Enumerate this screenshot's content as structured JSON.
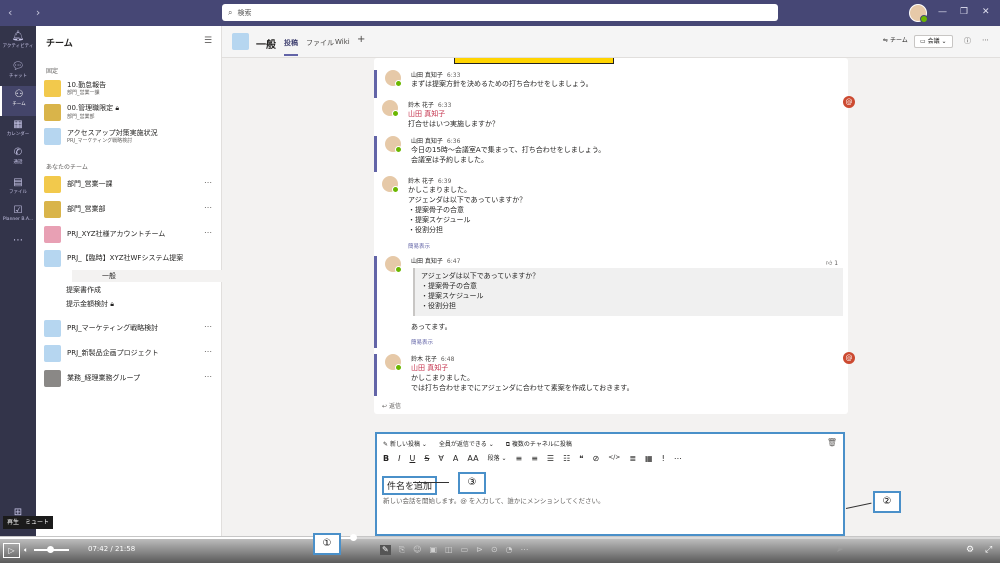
{
  "search": {
    "placeholder": "検索"
  },
  "rail": [
    {
      "label": "アクティビティ",
      "icon": "bell-icon"
    },
    {
      "label": "チャット",
      "icon": "chat-icon"
    },
    {
      "label": "チーム",
      "icon": "teams-icon"
    },
    {
      "label": "カレンダー",
      "icon": "calendar-icon"
    },
    {
      "label": "通話",
      "icon": "phone-icon"
    },
    {
      "label": "ファイル",
      "icon": "file-icon"
    },
    {
      "label": "Planner B.A...",
      "icon": "planner-icon"
    }
  ],
  "teams_pane": {
    "title": "チーム",
    "pinned_label": "固定",
    "pinned": [
      {
        "name": "10.勤怠報告",
        "sub": "部門_営業一課"
      },
      {
        "name": "00.管理職限定",
        "sub": "部門_営業部"
      },
      {
        "name": "アクセスアップ対策実施状況",
        "sub": "PRJ_マーケティング戦略検討"
      }
    ],
    "your_teams_label": "あなたのチーム",
    "teams": [
      {
        "name": "部門_営業一課"
      },
      {
        "name": "部門_営業部"
      },
      {
        "name": "PRJ_XYZ社様アカウントチーム"
      },
      {
        "name": "PRJ_【臨時】XYZ社WFシステム提案"
      },
      {
        "name": "PRJ_マーケティング戦略検討"
      },
      {
        "name": "PRJ_新製品企画プロジェクト"
      },
      {
        "name": "業務_経理業務グループ"
      }
    ],
    "channels": [
      "一般",
      "提案書作成",
      "提示金額検討"
    ]
  },
  "header": {
    "title": "一般",
    "tabs": [
      "投稿",
      "ファイル",
      "Wiki"
    ],
    "team_btn": "チーム",
    "meet_btn": "会議"
  },
  "messages": [
    {
      "author": "山田 真知子",
      "time": "6:33",
      "lines": [
        "まずは提案方針を決めるための打ち合わせをしましょう。"
      ]
    },
    {
      "author": "鈴木 花子",
      "time": "6:33",
      "mention": "山田 真知子",
      "lines": [
        "打合せはいつ実施しますか？"
      ]
    },
    {
      "author": "山田 真知子",
      "time": "6:36",
      "lines": [
        "今日の15時～会議室Aで集まって、打ち合わせをしましょう。",
        "会議室は予約しました。"
      ]
    },
    {
      "author": "鈴木 花子",
      "time": "6:39",
      "lines": [
        "かしこまりました。",
        "アジェンダは以下であっていますか？",
        "・提案骨子の合意",
        "・提案スケジュール",
        "・役割分担"
      ]
    },
    {
      "author": "山田 真知子",
      "time": "6:47",
      "quote": [
        "アジェンダは以下であっていますか？",
        "・提案骨子の合意",
        "・提案スケジュール",
        "・役割分担"
      ],
      "lines": [
        "あってます。"
      ]
    },
    {
      "author": "鈴木 花子",
      "time": "6:48",
      "mention": "山田 真知子",
      "lines": [
        "かしこまりました。",
        "では打ち合わせまでにアジェンダに合わせて素案を作成しておきます。"
      ]
    }
  ],
  "show_less": "簡易表示",
  "reply": "返信",
  "like_count": "1",
  "composer": {
    "post_type": "新しい投稿",
    "reply_setting": "全員が返信できる",
    "multi_channel": "複数のチャネルに投稿",
    "subject": "件名を追加",
    "placeholder": "新しい会話を開始します。@ を入力して、誰かにメンションしてください。",
    "format_items": [
      "B",
      "I",
      "U",
      "S",
      "∀",
      "A",
      "AA",
      "段落 ⌄",
      "≡",
      "≡",
      "☰",
      "☷",
      "❝",
      "⊘",
      "</>",
      "≣",
      "▦",
      "!",
      "⋯"
    ]
  },
  "callouts": [
    "①",
    "②",
    "③"
  ],
  "player": {
    "tooltip": "再生　ミュート",
    "current": "07:42",
    "separator": "/",
    "total": "21:58",
    "progress": 0.353
  }
}
